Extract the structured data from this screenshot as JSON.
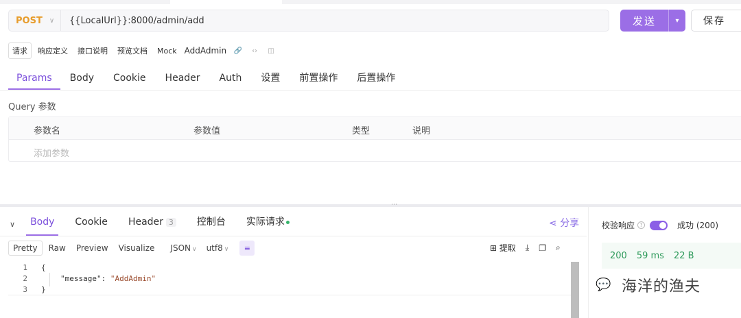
{
  "request": {
    "method": "POST",
    "url": "{{LocalUrl}}:8000/admin/add",
    "send_label": "发送",
    "save_label": "保存"
  },
  "doc_tabs": {
    "items": [
      "请求",
      "响应定义",
      "接口说明",
      "预览文档",
      "Mock"
    ],
    "name": "AddAdmin"
  },
  "params_tabs": [
    "Params",
    "Body",
    "Cookie",
    "Header",
    "Auth",
    "设置",
    "前置操作",
    "后置操作"
  ],
  "query": {
    "title": "Query 参数",
    "columns": [
      "参数名",
      "参数值",
      "类型",
      "说明"
    ],
    "add_placeholder": "添加参数"
  },
  "response": {
    "tabs": {
      "body": "Body",
      "cookie": "Cookie",
      "header": "Header",
      "header_count": "3",
      "console": "控制台",
      "actual": "实际请求"
    },
    "share": "分享",
    "format_tabs": [
      "Pretty",
      "Raw",
      "Preview",
      "Visualize"
    ],
    "format": "JSON",
    "encoding": "utf8",
    "extract": "提取",
    "code_lines": [
      {
        "num": "1",
        "text": "{"
      },
      {
        "num": "2",
        "key": "\"message\"",
        "value": "\"AddAdmin\""
      },
      {
        "num": "3",
        "text": "}"
      }
    ]
  },
  "validation": {
    "label": "校验响应",
    "result": "成功 (200)",
    "status": "200",
    "time": "59 ms",
    "size": "22 B"
  },
  "watermark": "海洋的渔夫",
  "colors": {
    "accent": "#9b6ee6",
    "method": "#e79c2c",
    "success": "#2e9a5b"
  }
}
